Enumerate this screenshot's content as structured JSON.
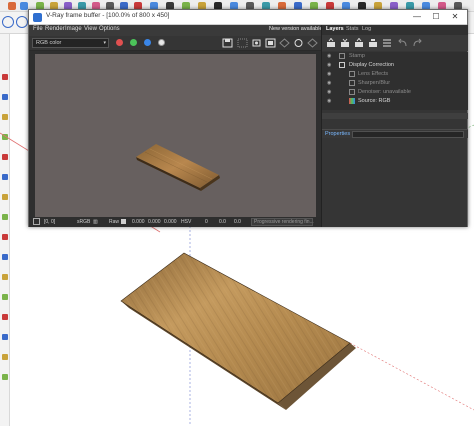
{
  "vfb": {
    "title": "V-Ray frame buffer - [100.0% of 800 x 450]",
    "minimize": "—",
    "maximize": "☐",
    "close": "✕",
    "menu": [
      "File",
      "Render",
      "Image",
      "View",
      "Options"
    ],
    "new_version": "New version available",
    "channel": "RGB color",
    "status": {
      "coords": "[0, 0]",
      "srgb": "sRGB",
      "raw": "Raw",
      "r": "0.000",
      "g": "0.000",
      "b": "0.000",
      "hsv": "HSV",
      "h": "0",
      "s": "0.0",
      "v": "0.0",
      "msg": "Progressive rendering fin..."
    },
    "panel": {
      "tabs": [
        "Layers",
        "Stats",
        "Log"
      ],
      "layers": [
        {
          "label": "Stamp",
          "dim": true
        },
        {
          "label": "Display Correction",
          "dim": false
        },
        {
          "label": "Lens Effects",
          "dim": true
        },
        {
          "label": "Sharpen/Blur",
          "dim": true
        },
        {
          "label": "Denoiser: unavailable",
          "dim": true
        },
        {
          "label": "Source: RGB",
          "dim": false
        }
      ],
      "properties": "Properties"
    }
  },
  "colors": {
    "accent": "#2f6fd0",
    "red": "#e05050",
    "green": "#4cc35a",
    "blue": "#3a86e8",
    "wood": "#b5884e",
    "edge": "#6d5537",
    "link": "#79b8ff"
  }
}
